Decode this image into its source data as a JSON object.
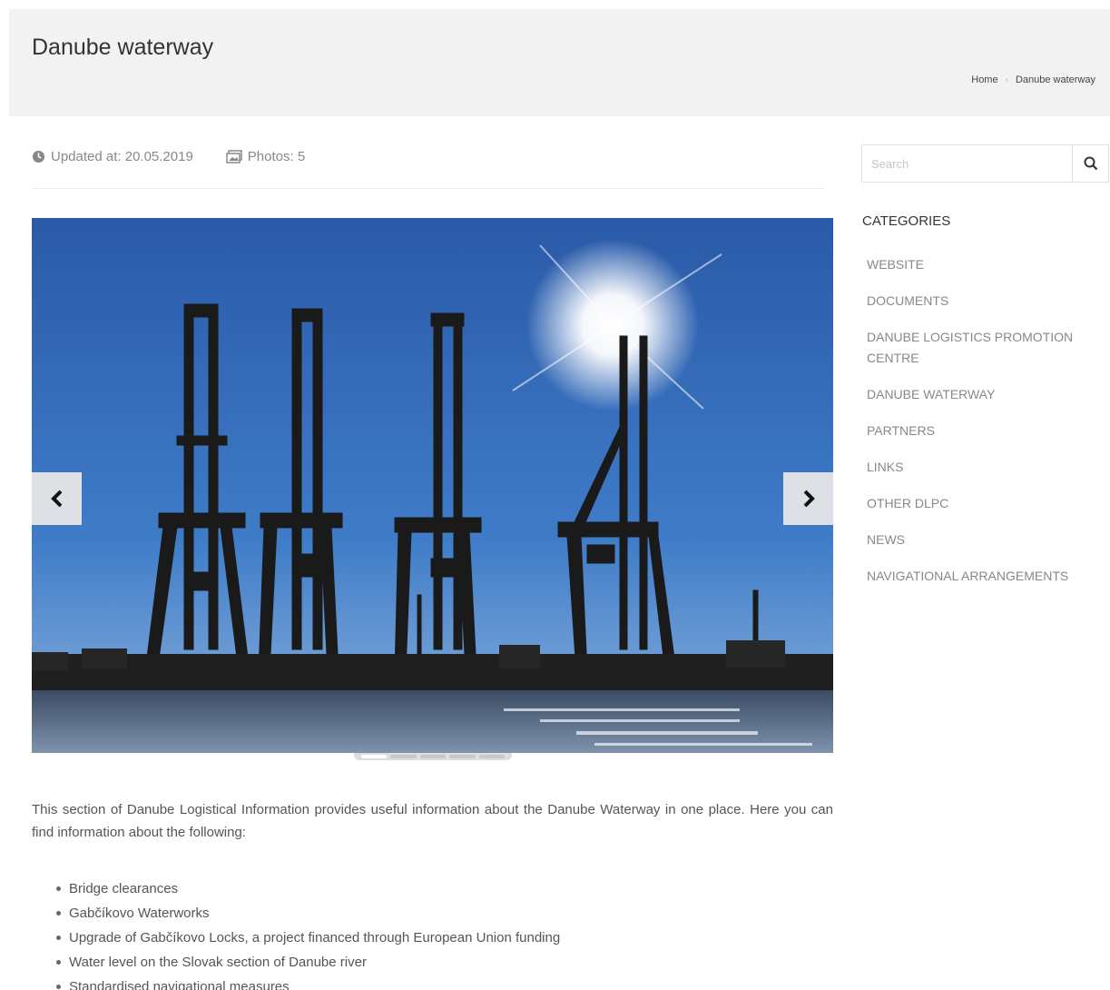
{
  "header": {
    "title": "Danube waterway",
    "breadcrumb": [
      {
        "label": "Home"
      },
      {
        "label": "Danube waterway"
      }
    ]
  },
  "meta": {
    "updated": "Updated at: 20.05.2019",
    "photos": "Photos: 5"
  },
  "gallery": {
    "photo_count": 5,
    "active_index": 0,
    "icons": [
      "chevron-left-icon",
      "chevron-right-icon"
    ]
  },
  "article": {
    "intro": "This section of Danube Logistical Information provides useful information about the Danube Waterway in one place. Here you can find information about the following:",
    "topics": [
      "Bridge clearances",
      "Gabčíkovo Waterworks",
      "Upgrade of Gabčíkovo Locks, a project financed through European Union funding",
      "Water level on the Slovak section of Danube river",
      "Standardised navigational measures"
    ]
  },
  "sidebar": {
    "search_placeholder": "Search",
    "categories_heading": "CATEGORIES",
    "categories": [
      "WEBSITE",
      "DOCUMENTS",
      "DANUBE LOGISTICS PROMOTION CENTRE",
      "DANUBE WATERWAY",
      "PARTNERS",
      "LINKS",
      "OTHER DLPC",
      "NEWS",
      "NAVIGATIONAL ARRANGEMENTS"
    ]
  },
  "colors": {
    "header_bg": "#f2f2f2",
    "sky": "#2e63b5",
    "text": "#555555",
    "muted": "#888888"
  }
}
